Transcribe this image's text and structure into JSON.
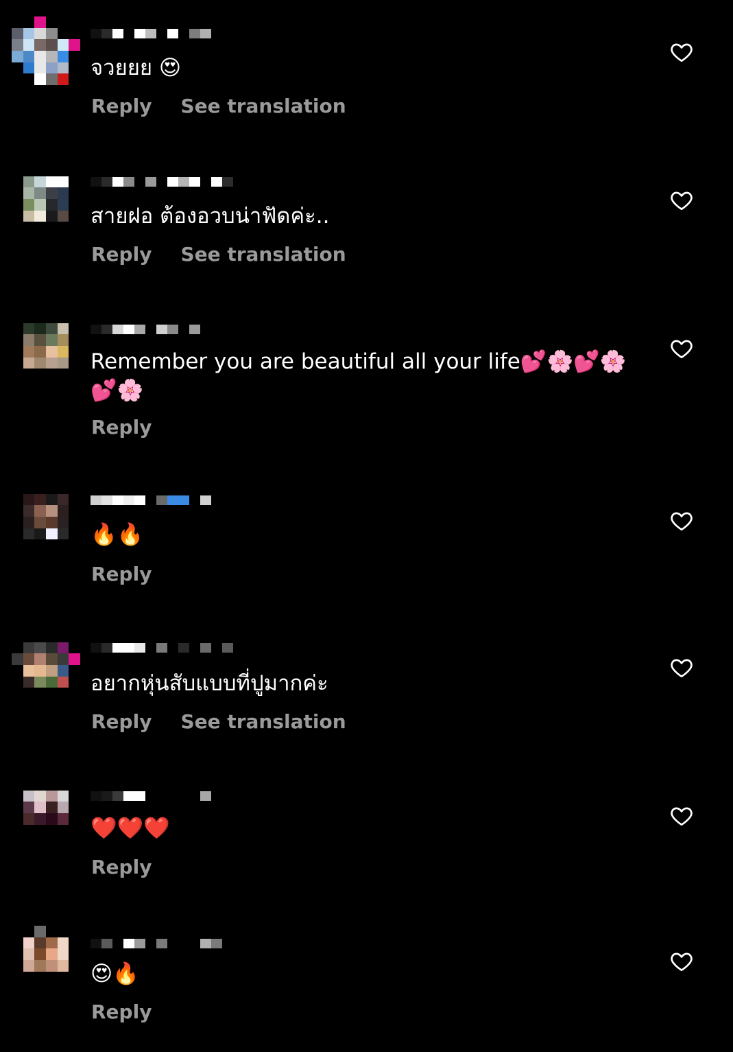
{
  "labels": {
    "reply": "Reply",
    "see_translation": "See translation"
  },
  "icons": {
    "like": "heart-outline-icon"
  },
  "comments": [
    {
      "text": "จวยยย 😍",
      "show_translation": true,
      "avatar_colors": [
        "#000",
        "#000",
        "#e0138a",
        "#000",
        "#000",
        "#000",
        "#5b5f6a",
        "#a6c6e6",
        "#d9d9d9",
        "#8d8d8d",
        "#000",
        "#000",
        "#7a7f8a",
        "#cde5f5",
        "#7a6a66",
        "#5b4e4c",
        "#cfe9f7",
        "#e0138a",
        "#7aaad6",
        "#4e89c7",
        "#e8e8e8",
        "#b7b7b7",
        "#3a8be6",
        "#000",
        "#000",
        "#2f7bd0",
        "#e8e8e8",
        "#8da1c7",
        "#b2bac9",
        "#000",
        "#000",
        "#000",
        "#ffffff",
        "#6e6e6e",
        "#d01a1a",
        "#000"
      ],
      "username_colors": [
        "#111",
        "#2a2a2a",
        "#ffffff",
        "#000",
        "#ffffff",
        "#bdbdbd",
        "#000",
        "#ffffff",
        "#000",
        "#7d7d7d",
        "#b0b0b0"
      ]
    },
    {
      "text": "สายฝอ ต้องอวบน่าฟัดค่ะ..",
      "show_translation": true,
      "avatar_colors": [
        "#000",
        "#000",
        "#000",
        "#000",
        "#000",
        "#000",
        "#000",
        "#8a9a8c",
        "#c7d7d9",
        "#ffffff",
        "#ffffff",
        "#000",
        "#000",
        "#a8b6a7",
        "#7f8a86",
        "#3b3f47",
        "#2b3a4e",
        "#000",
        "#000",
        "#7a8e60",
        "#b9c7b4",
        "#26282c",
        "#2b3d52",
        "#000",
        "#000",
        "#c7bca4",
        "#f1eadd",
        "#1a1a1a",
        "#5a4a45",
        "#000",
        "#000",
        "#000",
        "#000",
        "#000",
        "#000",
        "#000"
      ],
      "username_colors": [
        "#111",
        "#2a2a2a",
        "#ffffff",
        "#8a8a8a",
        "#000",
        "#9a9a9a",
        "#000",
        "#ffffff",
        "#b5b5b5",
        "#ffffff",
        "#000",
        "#ffffff",
        "#2c2c2c"
      ]
    },
    {
      "text": "Remember you are beautiful all your life💕🌸💕🌸💕🌸",
      "show_translation": false,
      "avatar_colors": [
        "#000",
        "#000",
        "#000",
        "#000",
        "#000",
        "#000",
        "#000",
        "#2c3a2c",
        "#1b2a1b",
        "#3e4a3e",
        "#c9c0b0",
        "#000",
        "#000",
        "#8a7c6a",
        "#5a5040",
        "#6a7a5a",
        "#a68e5c",
        "#000",
        "#000",
        "#a07a5a",
        "#8a6a4a",
        "#e8c0a0",
        "#d9b860",
        "#000",
        "#000",
        "#c8a890",
        "#a08870",
        "#b8a090",
        "#a89888",
        "#000",
        "#000",
        "#000",
        "#000",
        "#000",
        "#000",
        "#000"
      ],
      "username_colors": [
        "#111",
        "#2a2a2a",
        "#d7d7d7",
        "#ffffff",
        "#a8a8a8",
        "#000",
        "#cfcfcf",
        "#8a8a8a",
        "#000",
        "#9a9a9a"
      ]
    },
    {
      "text": "🔥🔥",
      "show_translation": false,
      "avatar_colors": [
        "#000",
        "#000",
        "#000",
        "#000",
        "#000",
        "#000",
        "#000",
        "#2a1818",
        "#3a1f1f",
        "#1a1a1a",
        "#3a2828",
        "#000",
        "#000",
        "#3a2a2a",
        "#8a6050",
        "#b89080",
        "#2a2020",
        "#000",
        "#000",
        "#2a2020",
        "#6a4a3a",
        "#5a3a2a",
        "#2a2222",
        "#000",
        "#000",
        "#2a2a2a",
        "#1a1a1a",
        "#f0f0ff",
        "#2a2a2a",
        "#000",
        "#000",
        "#000",
        "#000",
        "#000",
        "#000",
        "#000"
      ],
      "username_colors": [
        "#cfcfcf",
        "#e2e2e2",
        "#ffffff",
        "#f0f0f0",
        "#ffffff",
        "#000",
        "#6a6a6a",
        "#3a8be6",
        "#3a8be6",
        "#000",
        "#d0d0d0"
      ]
    },
    {
      "text": "อยากหุ่นสับแบบที่ปูมากค่ะ",
      "show_translation": true,
      "avatar_colors": [
        "#000",
        "#000",
        "#000",
        "#000",
        "#000",
        "#000",
        "#000",
        "#3a3a3a",
        "#4a4a4a",
        "#2a2a2a",
        "#7a1a6a",
        "#000",
        "#3a3a3a",
        "#6a4a3a",
        "#b08070",
        "#5a4a3a",
        "#3a3a3a",
        "#e0138a",
        "#000",
        "#e8c09a",
        "#e6b890",
        "#c0a080",
        "#3a5a8a",
        "#000",
        "#000",
        "#3a2a2a",
        "#7a8a5a",
        "#4a6a3a",
        "#c05050",
        "#000",
        "#000",
        "#000",
        "#000",
        "#000",
        "#000",
        "#000"
      ],
      "username_colors": [
        "#111",
        "#2a2a2a",
        "#ffffff",
        "#ffffff",
        "#e8e8e8",
        "#000",
        "#7a7a7a",
        "#000",
        "#2a2a2a",
        "#000",
        "#6a6a6a",
        "#000",
        "#5a5a5a"
      ]
    },
    {
      "text": "❤️❤️❤️",
      "show_translation": false,
      "avatar_colors": [
        "#000",
        "#000",
        "#000",
        "#000",
        "#000",
        "#000",
        "#000",
        "#c8c0c8",
        "#e0d8d0",
        "#b89898",
        "#d8d8d8",
        "#000",
        "#000",
        "#5a3a4a",
        "#e0c0c8",
        "#3a2020",
        "#b8a8b0",
        "#000",
        "#000",
        "#4a2a2a",
        "#3a1a2a",
        "#2a0a1a",
        "#5a2a3a",
        "#000",
        "#000",
        "#000",
        "#000",
        "#000",
        "#000",
        "#000",
        "#000",
        "#000",
        "#000",
        "#000",
        "#000",
        "#000"
      ],
      "username_colors": [
        "#111",
        "#1a1a1a",
        "#3a3a3a",
        "#ffffff",
        "#ffffff",
        "#000",
        "#000",
        "#000",
        "#000",
        "#000",
        "#a8a8a8"
      ]
    },
    {
      "text": "😍🔥",
      "show_translation": false,
      "avatar_colors": [
        "#000",
        "#000",
        "#6a6a6a",
        "#000",
        "#000",
        "#000",
        "#000",
        "#f0d0c8",
        "#5a3a2a",
        "#a06a4a",
        "#f0d8c8",
        "#000",
        "#000",
        "#e0c0b0",
        "#7a4a2a",
        "#e8a888",
        "#f0d8c8",
        "#000",
        "#000",
        "#d0a898",
        "#a0785a",
        "#c09078",
        "#e0b8a0",
        "#000",
        "#000",
        "#000",
        "#000",
        "#000",
        "#000",
        "#000",
        "#000",
        "#000",
        "#000",
        "#000",
        "#000",
        "#000"
      ],
      "username_colors": [
        "#111",
        "#5a5a5a",
        "#000",
        "#ffffff",
        "#9a9a9a",
        "#000",
        "#7a7a7a",
        "#000",
        "#000",
        "#000",
        "#b0b0b0",
        "#7a7a7a"
      ]
    }
  ]
}
